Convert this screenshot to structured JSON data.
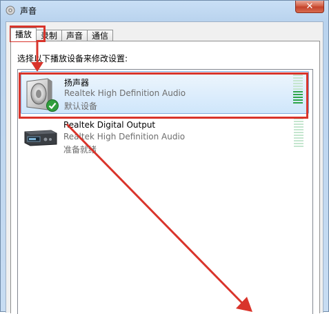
{
  "window": {
    "title": "声音",
    "close_label": "✕"
  },
  "tabs": [
    {
      "label": "播放",
      "active": true
    },
    {
      "label": "录制",
      "active": false
    },
    {
      "label": "声音",
      "active": false
    },
    {
      "label": "通信",
      "active": false
    }
  ],
  "instruction": "选择以下播放设备来修改设置:",
  "devices": [
    {
      "name": "扬声器",
      "driver": "Realtek High Definition Audio",
      "status": "默认设备",
      "icon": "speaker-icon",
      "default_badge": "check-icon",
      "selected": true
    },
    {
      "name": "Realtek Digital Output",
      "driver": "Realtek High Definition Audio",
      "status": "准备就绪",
      "icon": "digital-output-icon",
      "selected": false
    }
  ],
  "colors": {
    "annotation": "#d9342b",
    "meter_lit": "#2ea64a",
    "meter_dim": "#c5e6cf",
    "selection": "#cfe6fb"
  }
}
